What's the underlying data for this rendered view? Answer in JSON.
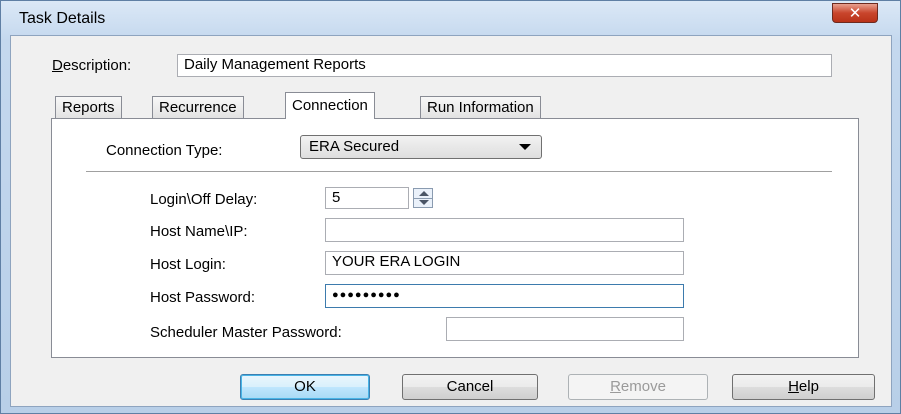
{
  "window": {
    "title": "Task Details",
    "close_label": "✕"
  },
  "description": {
    "label_key": "D",
    "label_rest": "escription:",
    "value": "Daily Management Reports"
  },
  "tabs": [
    {
      "label": "Reports"
    },
    {
      "label": "Recurrence"
    },
    {
      "label": "Connection"
    },
    {
      "label": "Run Information"
    }
  ],
  "connection": {
    "type_label": "Connection Type:",
    "type_value": "ERA Secured",
    "delay_label": "Login\\Off Delay:",
    "delay_value": "5",
    "host_label": "Host Name\\IP:",
    "host_value": "",
    "login_label": "Host Login:",
    "login_value": "YOUR ERA LOGIN",
    "password_label": "Host Password:",
    "password_value": "●●●●●●●●●",
    "master_label": "Scheduler Master Password:",
    "master_value": ""
  },
  "buttons": {
    "ok": "OK",
    "cancel": "Cancel",
    "remove_key": "R",
    "remove_rest": "emove",
    "help_key": "H",
    "help_rest": "elp"
  }
}
